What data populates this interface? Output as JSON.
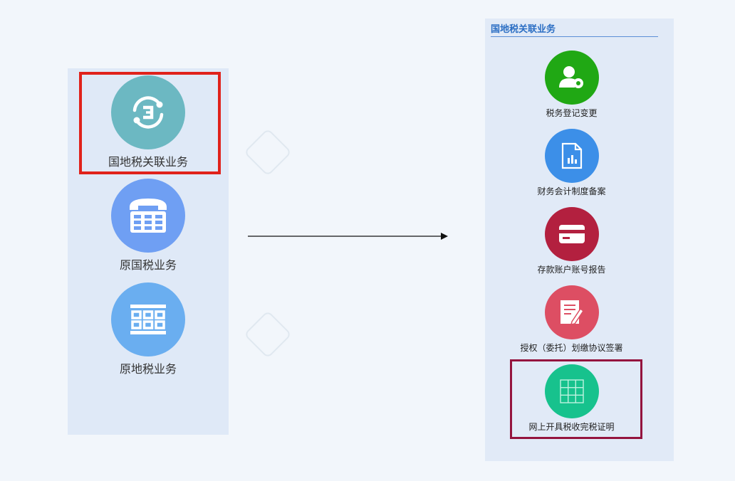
{
  "left_menu": {
    "items": [
      {
        "label": "国地税关联业务",
        "icon": "exchange-icon",
        "color": "#6cb8c2"
      },
      {
        "label": "原国税业务",
        "icon": "telephone-icon",
        "color": "#6f9ff3"
      },
      {
        "label": "原地税业务",
        "icon": "grid-icon",
        "color": "#6aaef0"
      }
    ],
    "highlight_color": "#e0221b"
  },
  "right_panel": {
    "title": "国地税关联业务",
    "items": [
      {
        "label": "税务登记变更",
        "icon": "user-settings-icon",
        "color": "#20a814"
      },
      {
        "label": "财务会计制度备案",
        "icon": "document-chart-icon",
        "color": "#3c8fe8"
      },
      {
        "label": "存款账户账号报告",
        "icon": "bank-card-icon",
        "color": "#b3203f"
      },
      {
        "label": "授权（委托）划缴协议签署",
        "icon": "edit-document-icon",
        "color": "#dd4e63"
      },
      {
        "label": "网上开具税收完税证明",
        "icon": "table-grid-icon",
        "color": "#17c28d"
      }
    ],
    "highlight_color": "#94143e"
  },
  "arrow": {
    "icon": "arrow-right-icon"
  }
}
